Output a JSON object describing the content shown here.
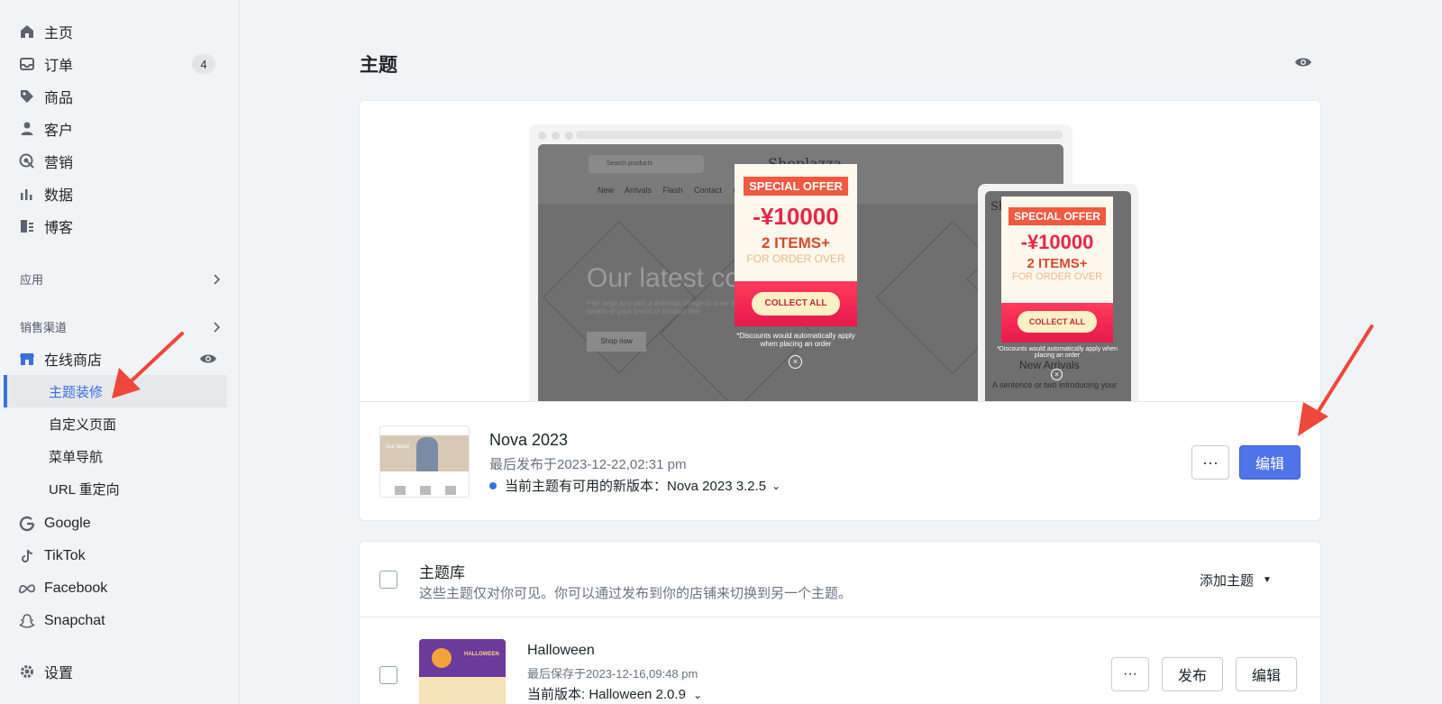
{
  "sidebar": {
    "main_items": [
      {
        "label": "主页",
        "icon": "home-icon"
      },
      {
        "label": "订单",
        "icon": "inbox-icon",
        "badge": "4"
      },
      {
        "label": "商品",
        "icon": "tag-icon"
      },
      {
        "label": "客户",
        "icon": "person-icon"
      },
      {
        "label": "营销",
        "icon": "target-icon"
      },
      {
        "label": "数据",
        "icon": "bar-chart-icon"
      },
      {
        "label": "博客",
        "icon": "blog-icon"
      }
    ],
    "apps_label": "应用",
    "channels_label": "销售渠道",
    "online_store": {
      "label": "在线商店",
      "sub_items": [
        "主题装修",
        "自定义页面",
        "菜单导航",
        "URL 重定向"
      ]
    },
    "channels": [
      "Google",
      "TikTok",
      "Facebook",
      "Snapchat"
    ],
    "settings_label": "设置"
  },
  "page": {
    "title": "主题"
  },
  "preview": {
    "search_placeholder": "Search products",
    "brand": "Shoplazza",
    "nav_links": "New Arrivals Flash Contact us",
    "hero_title": "Our latest co",
    "hero_text": "Pair large text with a dramatic image to draw the details of your brand or product line",
    "shop_now": "Shop now",
    "coupon": {
      "tag": "SPECIAL OFFER",
      "amount": "-¥10000",
      "items": "2 ITEMS+",
      "order": "FOR ORDER OVER",
      "collect": "COLLECT ALL",
      "note": "*Discounts would automatically apply when placing an order"
    },
    "phone_brand": "Sh",
    "phone_new_arrivals": "New Arrivals",
    "phone_text": "A sentence or two introducing your"
  },
  "current_theme": {
    "name": "Nova 2023",
    "meta": "最后发布于2023-12-22,02:31 pm",
    "update_text": "当前主题有可用的新版本：Nova 2023 3.2.5",
    "more_label": "···",
    "edit_label": "编辑",
    "thumb_caption": "Our latest"
  },
  "library": {
    "title": "主题库",
    "description": "这些主题仅对你可见。你可以通过发布到你的店铺来切换到另一个主题。",
    "add_theme_label": "添加主题",
    "items": [
      {
        "name": "Halloween",
        "meta": "最后保存于2023-12-16,09:48 pm",
        "version": "当前版本: Halloween 2.0.9",
        "more_label": "···",
        "publish_label": "发布",
        "edit_label": "编辑",
        "thumb_text": "HALLOWEEN"
      }
    ]
  },
  "colors": {
    "accent": "#4f74e8",
    "active_nav": "#3b6fe0",
    "arrow": "#f0473d"
  }
}
